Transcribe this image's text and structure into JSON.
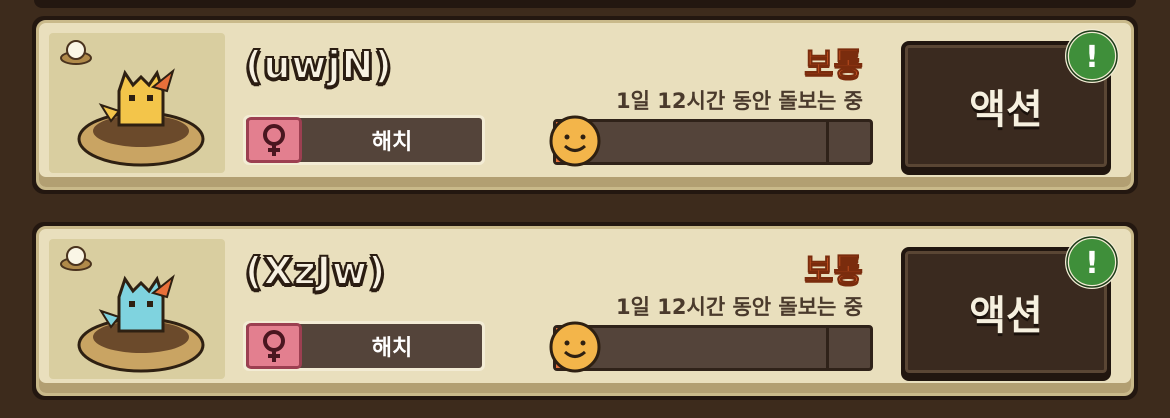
{
  "pets": [
    {
      "name": "(uwjN)",
      "stage": "해치",
      "gender_icon": "female-icon",
      "condition": "보통",
      "care_time": "1일 12시간 동안 돌보는 중",
      "mood_fraction": 0.02,
      "creature_color": "#f3c54a",
      "action_label": "액션",
      "alert": "!"
    },
    {
      "name": "(XzJw)",
      "stage": "해치",
      "gender_icon": "female-icon",
      "condition": "보통",
      "care_time": "1일 12시간 동안 돌보는 중",
      "mood_fraction": 0.02,
      "creature_color": "#7fd3df",
      "action_label": "액션",
      "alert": "!"
    }
  ]
}
